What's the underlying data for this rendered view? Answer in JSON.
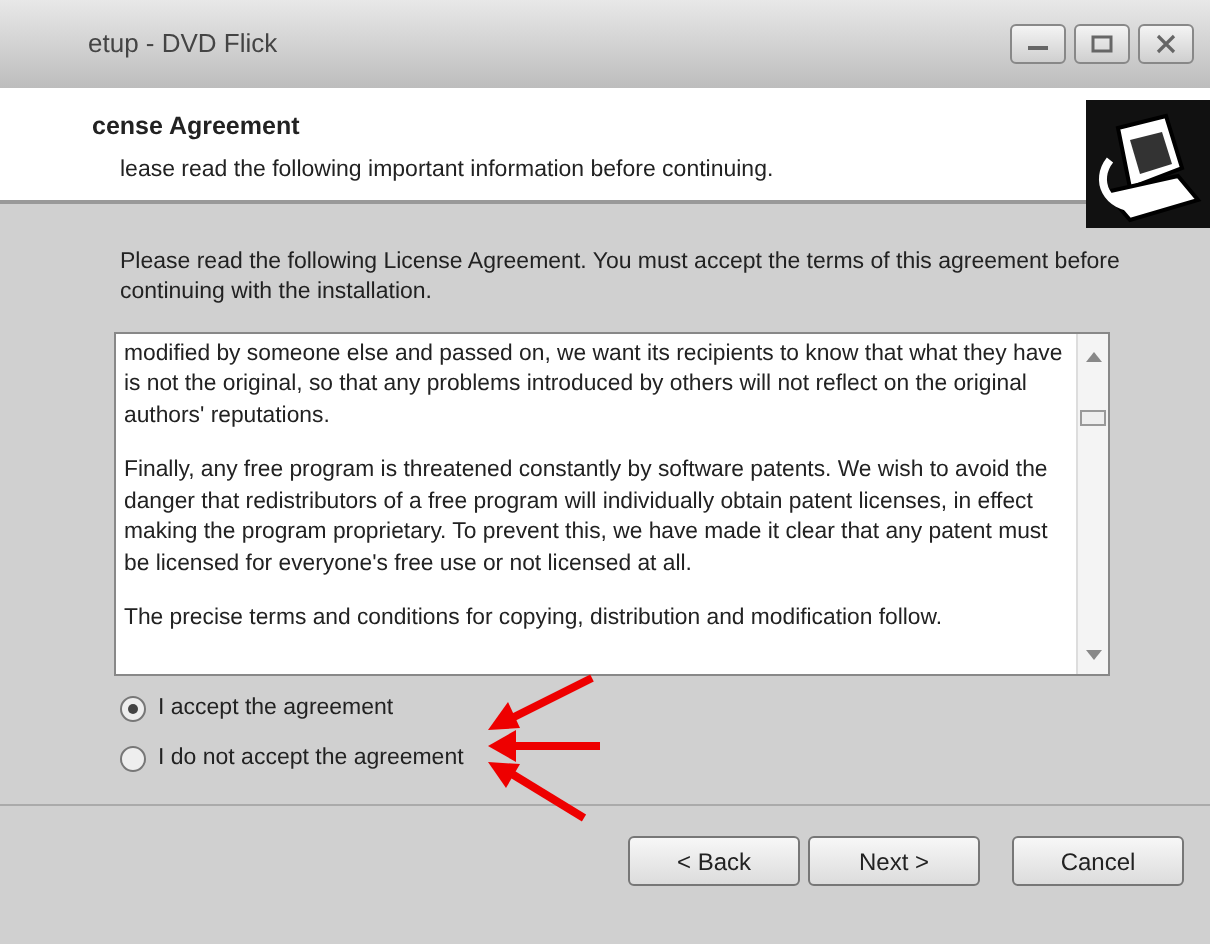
{
  "window": {
    "title": "etup - DVD Flick"
  },
  "header": {
    "title": "cense Agreement",
    "subtitle": "lease read the following important information before continuing."
  },
  "intro": "Please read the following License Agreement. You must accept the terms of this agreement before continuing with the installation.",
  "license_text": [
    "modified by someone else and passed on, we want its recipients to know that what they have is not the original, so that any problems introduced by others will not reflect on the original authors' reputations.",
    "Finally, any free program is threatened constantly by software patents. We wish to avoid the danger that redistributors of a free program will individually obtain patent licenses, in effect making the program proprietary. To prevent this, we have made it clear that any patent must be licensed for everyone's free use or not licensed at all.",
    "The precise terms and conditions for copying, distribution and modification follow."
  ],
  "options": [
    {
      "label": "I accept the agreement",
      "selected": true
    },
    {
      "label": "I do not accept the agreement",
      "selected": false
    }
  ],
  "buttons": [
    "< Back",
    "Next >",
    "Cancel"
  ]
}
